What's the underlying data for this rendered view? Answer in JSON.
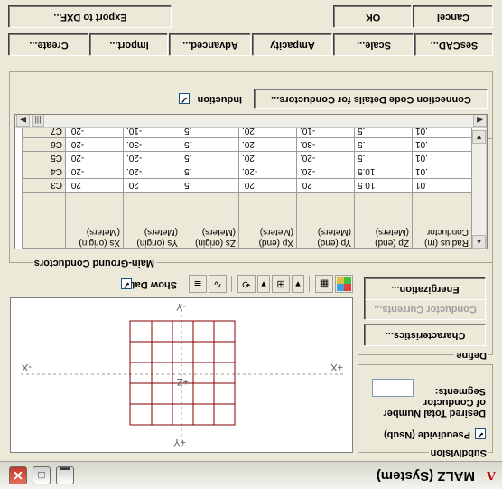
{
  "window": {
    "title": "MALZ (System)"
  },
  "subdivision": {
    "legend": "Subdivision",
    "pseudivide_label": "Pseudivide (Nsub)",
    "pseudivide_checked": true,
    "desired_label_1": "Desired Total Number",
    "desired_label_2": "of Conductor",
    "desired_label_3": "Segments:",
    "desired_value": ""
  },
  "define": {
    "legend": "Define",
    "characteristics": "Characteristics...",
    "conductor_currents": "Conductor Currents...",
    "energization": "Energization..."
  },
  "plot_toolbar": {
    "show_data_label": "Show Data",
    "show_data_checked": true
  },
  "plot": {
    "x_pos": "+X",
    "x_neg": "-X",
    "y_pos": "+Y",
    "y_neg": "-Y",
    "z_label": "+Z"
  },
  "conductors": {
    "legend": "Main-Ground Conductors",
    "columns": [
      "Xs (origin) (Meters)",
      "Ys (origin) (Meters)",
      "Zs (origin) (Meters)",
      "Xp (end) (Meters)",
      "Yp (end) (Meters)",
      "Zp (end) (Meters)",
      "Radius (m) Conductor"
    ],
    "rows": [
      {
        "label": "C3",
        "cells": [
          "20.",
          "20.",
          ".5",
          "20.",
          "20.",
          "10.5",
          ".01"
        ]
      },
      {
        "label": "C4",
        "cells": [
          "-20.",
          "-20.",
          ".5",
          "-20.",
          "-20.",
          "10.5",
          ".01"
        ]
      },
      {
        "label": "C5",
        "cells": [
          "-20.",
          "-20.",
          ".5",
          "20.",
          "-20.",
          ".5",
          ".01"
        ]
      },
      {
        "label": "C6",
        "cells": [
          "-20.",
          "-30.",
          ".5",
          "20.",
          "-30.",
          ".5",
          ".01"
        ]
      },
      {
        "label": "C7",
        "cells": [
          "-20.",
          "-10.",
          ".5",
          "20.",
          "-10.",
          ".5",
          ".01"
        ]
      }
    ],
    "induction_label": "Induction",
    "induction_checked": true,
    "connection_button": "Connection Code Details for Conductors..."
  },
  "tabs": [
    "Create...",
    "Import...",
    "Advanced...",
    "Ampacity",
    "Scale...",
    "SesCAD..."
  ],
  "bottom_buttons": {
    "export": "Export to DXF...",
    "ok": "OK",
    "cancel": "Cancel"
  },
  "colors": {
    "grid_lines": "#800000",
    "titlebar_close": "#c0392b"
  }
}
